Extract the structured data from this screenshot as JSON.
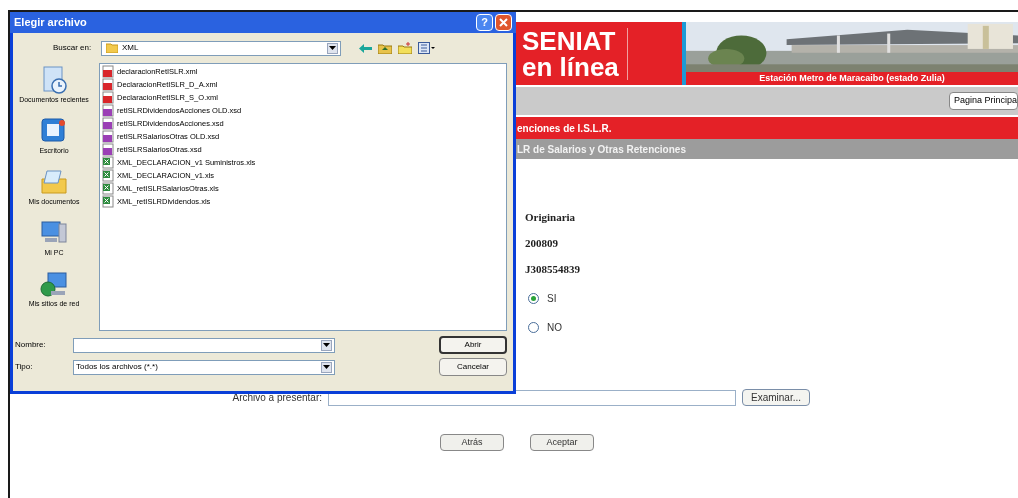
{
  "page": {
    "logo": [
      "SENIAT",
      "en línea"
    ],
    "photo_caption": "Estación Metro de Maracaibo (estado Zulia)",
    "home_button": "Pagina Principa",
    "section_bar": "enciones de I.S.L.R.",
    "subsection_bar": "LR de Salarios y Otras Retenciones",
    "values": [
      "Originaria",
      "200809",
      "J308554839"
    ],
    "radios": [
      {
        "label": "SI",
        "selected": true
      },
      {
        "label": "NO",
        "selected": false
      }
    ],
    "file_label": "Archivo a presentar:",
    "browse_button": "Examinar...",
    "buttons": [
      "Atrás",
      "Aceptar"
    ]
  },
  "dialog": {
    "title": "Elegir archivo",
    "help": "?",
    "look_in_label": "Buscar en:",
    "look_in_value": "XML",
    "places": [
      {
        "label": "Documentos recientes",
        "kind": "recent"
      },
      {
        "label": "Escritorio",
        "kind": "desktop"
      },
      {
        "label": "Mis documentos",
        "kind": "documents"
      },
      {
        "label": "Mi PC",
        "kind": "computer"
      },
      {
        "label": "Mis sitios de red",
        "kind": "network"
      }
    ],
    "files": [
      {
        "name": "declaracionRetISLR.xml",
        "kind": "xml"
      },
      {
        "name": "DeclaracionRetISLR_D_A.xml",
        "kind": "xml"
      },
      {
        "name": "DeclaracionRetISLR_S_O.xml",
        "kind": "xml"
      },
      {
        "name": "retISLRDividendosAcciones OLD.xsd",
        "kind": "xsd"
      },
      {
        "name": "retISLRDividendosAcciones.xsd",
        "kind": "xsd"
      },
      {
        "name": "retISLRSalariosOtras OLD.xsd",
        "kind": "xsd"
      },
      {
        "name": "retISLRSalariosOtras.xsd",
        "kind": "xsd"
      },
      {
        "name": "XML_DECLARACION_v1 Suministros.xls",
        "kind": "xls"
      },
      {
        "name": "XML_DECLARACION_v1.xls",
        "kind": "xls"
      },
      {
        "name": "XML_retISLRSalariosOtras.xls",
        "kind": "xls"
      },
      {
        "name": "XML_retISLRDividendos.xls",
        "kind": "xls"
      }
    ],
    "name_label": "Nombre:",
    "type_label": "Tipo:",
    "type_value": "Todos los archivos (*.*)",
    "buttons": [
      "Abrir",
      "Cancelar"
    ]
  }
}
